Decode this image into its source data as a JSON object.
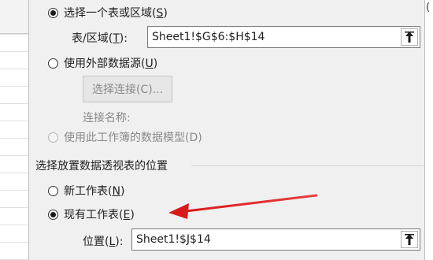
{
  "dialog": {
    "select_table_option": {
      "prefix": "选择一个表或区域(",
      "key": "S",
      "suffix": ")"
    },
    "table_range": {
      "label_prefix": "表/区域(",
      "label_key": "T",
      "label_suffix": "):",
      "value": "Sheet1!$G$6:$H$14"
    },
    "external_source_option": {
      "prefix": "使用外部数据源(",
      "key": "U",
      "suffix": ")"
    },
    "choose_connection_button": "选择连接(C)...",
    "connection_name_label": "连接名称:",
    "data_model_option": "使用此工作簿的数据模型(D)",
    "placement_section_title": "选择放置数据透视表的位置",
    "new_worksheet_option": {
      "prefix": "新工作表(",
      "key": "N",
      "suffix": ")"
    },
    "existing_worksheet_option": {
      "prefix": "现有工作表(",
      "key": "E",
      "suffix": ")"
    },
    "location": {
      "label_prefix": "位置(",
      "label_key": "L",
      "label_suffix": "):",
      "value": "Sheet1!$J$14"
    },
    "right_edge_glyph": "(",
    "picker_icon": "collapse-arrow-icon"
  },
  "annotation": {
    "arrow_color": "#e02020"
  }
}
